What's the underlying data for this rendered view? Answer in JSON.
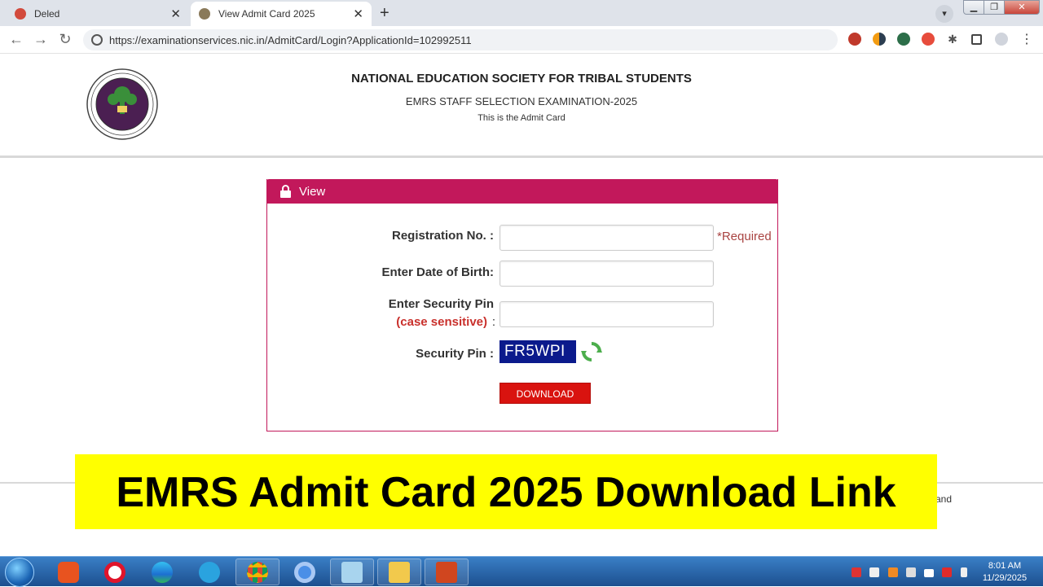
{
  "browser": {
    "tabs": [
      {
        "title": "Deled",
        "active": false
      },
      {
        "title": "View Admit Card 2025",
        "active": true
      }
    ],
    "new_tab": "+",
    "tab_close": "✕",
    "url": "https://examinationservices.nic.in/AdmitCard/Login?ApplicationId=102992511"
  },
  "header": {
    "org": "NATIONAL EDUCATION SOCIETY FOR TRIBAL STUDENTS",
    "exam": "EMRS STAFF SELECTION EXAMINATION-2025",
    "subtitle": "This is the Admit Card"
  },
  "panel": {
    "title": "View",
    "registration_label": "Registration No. :",
    "required_text": "*Required",
    "dob_label": "Enter Date of Birth:",
    "security_label_1": "Enter Security Pin",
    "security_label_2": "(case sensitive)",
    "security_label_colon": ":",
    "security_pin_label": "Security Pin :",
    "captcha": "FR5WPI",
    "download": "DOWNLOAD"
  },
  "footer": {
    "fragment": "and"
  },
  "banner": {
    "text": "EMRS Admit Card 2025 Download Link"
  },
  "taskbar": {
    "time": "8:01 AM",
    "date": "11/29/2025"
  },
  "colors": {
    "accent": "#c2185b",
    "download": "#d9130f",
    "captcha_bg": "#0b1a8c",
    "banner": "#ffff00"
  }
}
